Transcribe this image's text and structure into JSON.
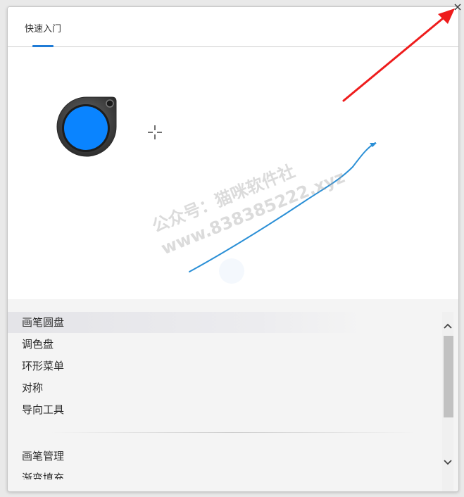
{
  "close_label": "×",
  "tabs": [
    {
      "label": "快速入门",
      "active": true
    }
  ],
  "list": {
    "items": [
      {
        "label": "画笔圆盘",
        "selected": true
      },
      {
        "label": "调色盘",
        "selected": false
      },
      {
        "label": "环形菜单",
        "selected": false
      },
      {
        "label": "对称",
        "selected": false
      },
      {
        "label": "导向工具",
        "selected": false
      },
      {
        "label": "画笔管理",
        "selected": false
      },
      {
        "label": "渐变填充",
        "selected": false
      }
    ]
  },
  "watermark": {
    "line1": "公众号：猫咪软件社",
    "line2": "www.838385222.xyz"
  },
  "colors": {
    "accent": "#1f7bd6",
    "brush_color": "#0a84ff",
    "stroke": "#2a8fd6",
    "annotation_arrow": "#ee1c1c"
  },
  "icons": {
    "brush_puck": "brush-puck-icon",
    "crosshair": "crosshair-icon",
    "close": "close-icon",
    "scroll_up": "chevron-up-icon",
    "scroll_down": "chevron-down-icon"
  }
}
